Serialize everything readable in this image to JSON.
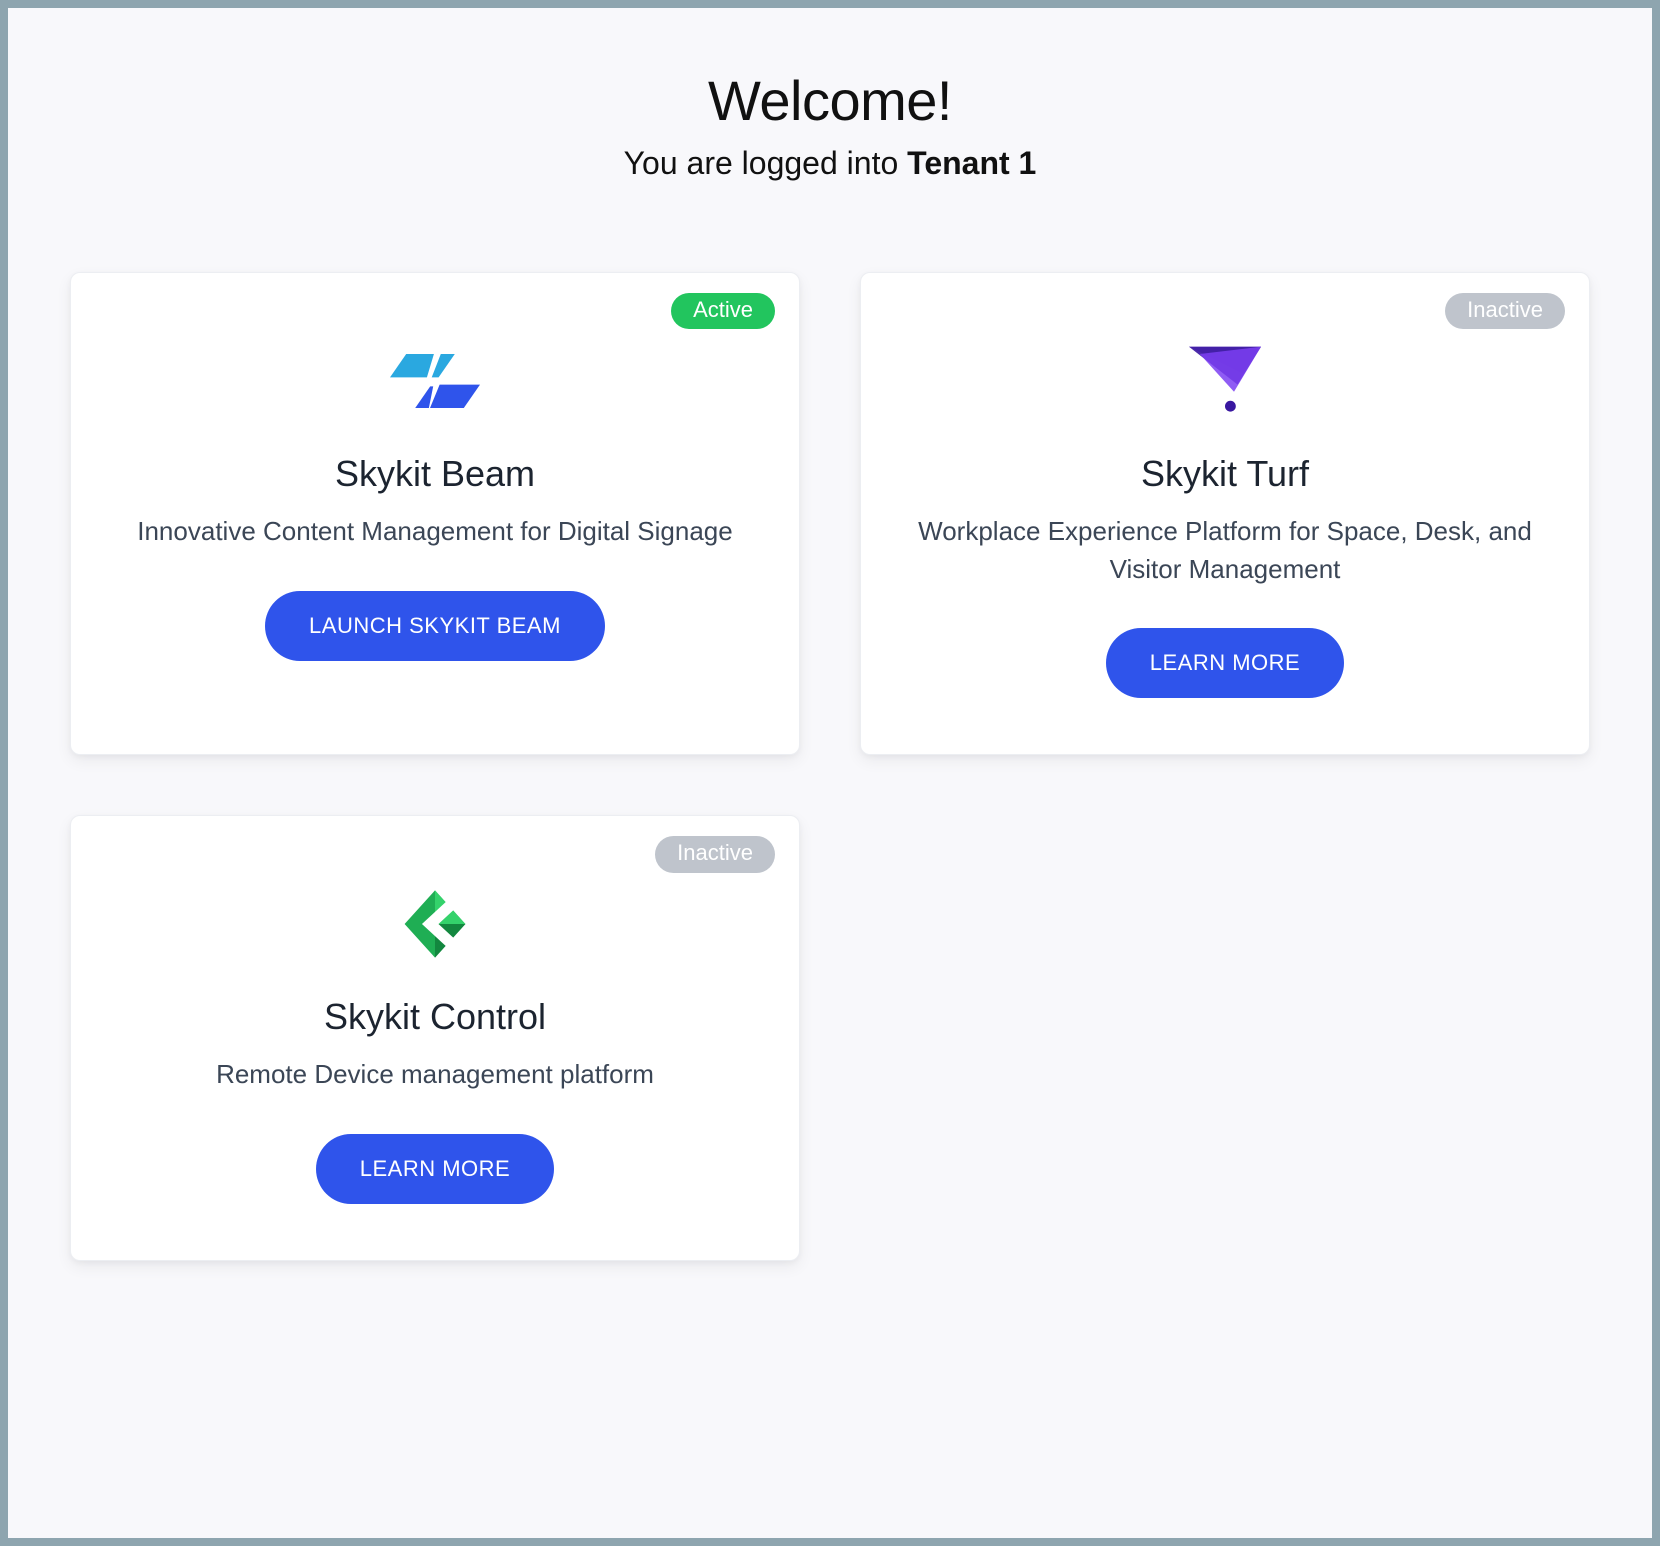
{
  "header": {
    "welcome": "Welcome!",
    "subhead_prefix": "You are logged into ",
    "tenant_name": "Tenant 1"
  },
  "cards": [
    {
      "id": "beam",
      "title": "Skykit Beam",
      "description": "Innovative Content Management for Digital Signage",
      "cta_label": "LAUNCH SKYKIT BEAM",
      "badge": {
        "text": "Active",
        "state": "active"
      },
      "icon": "beam"
    },
    {
      "id": "turf",
      "title": "Skykit Turf",
      "description": "Workplace Experience Platform for Space, Desk, and Visitor Management",
      "cta_label": "LEARN MORE",
      "badge": {
        "text": "Inactive",
        "state": "inactive"
      },
      "icon": "turf"
    },
    {
      "id": "control",
      "title": "Skykit Control",
      "description": "Remote Device management platform",
      "cta_label": "LEARN MORE",
      "badge": {
        "text": "Inactive",
        "state": "inactive"
      },
      "icon": "control"
    }
  ]
}
